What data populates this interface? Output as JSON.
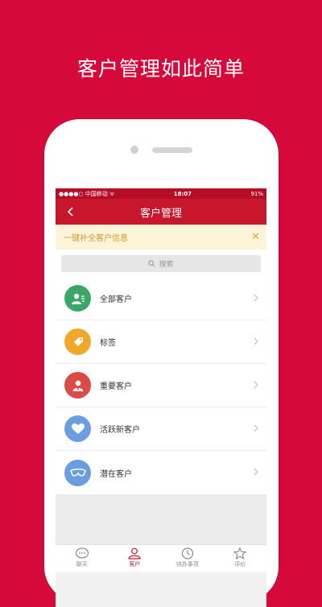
{
  "headline": "客户管理如此简单",
  "status_bar": {
    "carrier": "●●●●○ 中国移动 ᯤ",
    "time": "18:07",
    "battery": "91%"
  },
  "nav": {
    "title": "客户管理"
  },
  "banner": {
    "text": "一键补全客户信息",
    "close": "✕"
  },
  "search": {
    "placeholder": "搜索"
  },
  "list": [
    {
      "label": "全部客户",
      "icon": "all-customers-icon",
      "color": "#3aa767"
    },
    {
      "label": "标签",
      "icon": "tag-icon",
      "color": "#f0a72b"
    },
    {
      "label": "重要客户",
      "icon": "important-customer-icon",
      "color": "#db4a45"
    },
    {
      "label": "活跃新客户",
      "icon": "heart-icon",
      "color": "#6a9ee0"
    },
    {
      "label": "潜在客户",
      "icon": "potential-customer-icon",
      "color": "#6a9ee0"
    }
  ],
  "tabs": [
    {
      "label": "聊天",
      "icon": "chat-icon",
      "active": false
    },
    {
      "label": "客户",
      "icon": "customer-icon",
      "active": true
    },
    {
      "label": "待办事项",
      "icon": "clock-icon",
      "active": false
    },
    {
      "label": "评价",
      "icon": "star-icon",
      "active": false
    }
  ],
  "colors": {
    "brand_red": "#d60a3a",
    "nav_red": "#c8162c",
    "banner_text": "#d09a2c"
  }
}
